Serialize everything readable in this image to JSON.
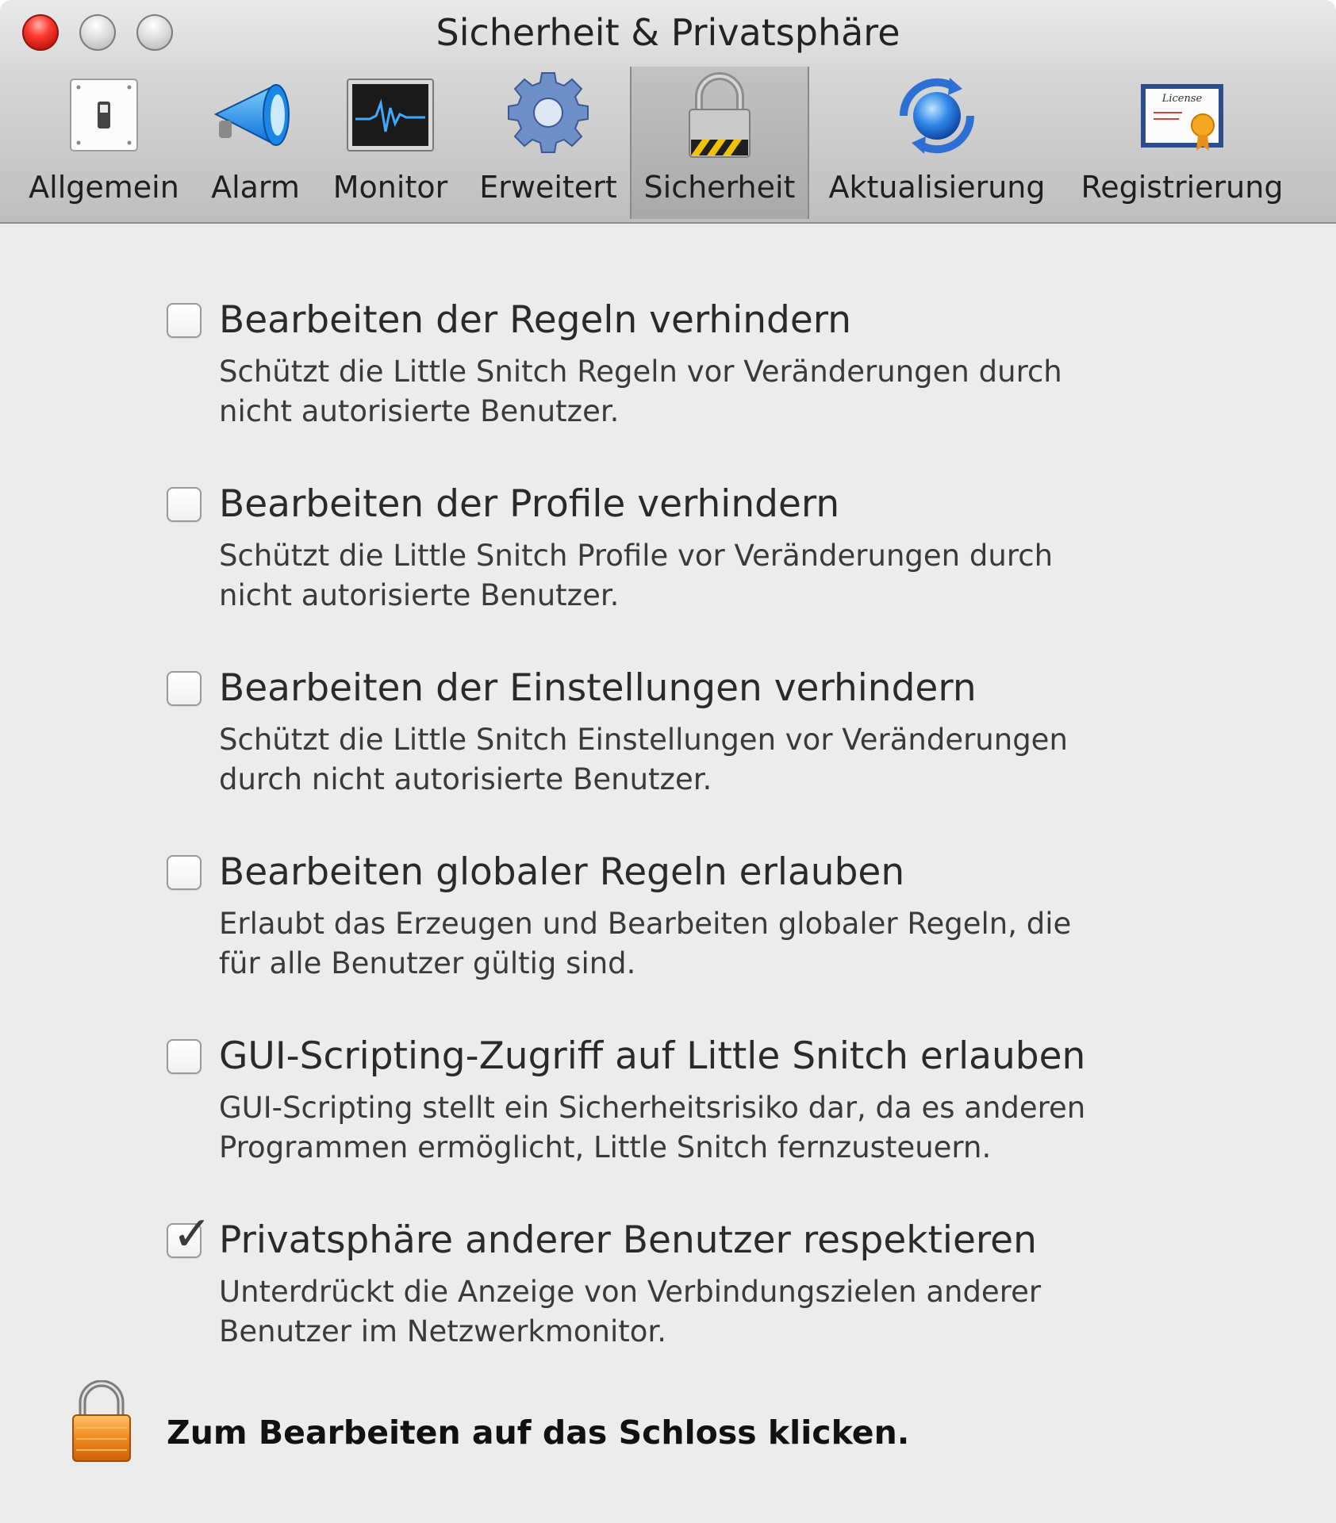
{
  "window": {
    "title": "Sicherheit & Privatsphäre"
  },
  "toolbar": {
    "tabs": [
      {
        "label": "Allgemein",
        "icon": "switch-icon"
      },
      {
        "label": "Alarm",
        "icon": "megaphone-icon"
      },
      {
        "label": "Monitor",
        "icon": "monitor-icon"
      },
      {
        "label": "Erweitert",
        "icon": "gear-icon"
      },
      {
        "label": "Sicherheit",
        "icon": "lock-icon",
        "selected": true
      },
      {
        "label": "Aktualisierung",
        "icon": "update-globe-icon"
      },
      {
        "label": "Registrierung",
        "icon": "license-certificate-icon"
      }
    ]
  },
  "options": [
    {
      "title": "Bearbeiten der Regeln verhindern",
      "desc_lines": [
        "Schützt die Little Snitch Regeln vor Veränderungen durch",
        "nicht autorisierte Benutzer."
      ],
      "checked": false
    },
    {
      "title": "Bearbeiten der Profile verhindern",
      "desc_lines": [
        "Schützt die Little Snitch Profile vor Veränderungen durch",
        "nicht autorisierte Benutzer."
      ],
      "checked": false
    },
    {
      "title": "Bearbeiten der Einstellungen verhindern",
      "desc_lines": [
        "Schützt die Little Snitch Einstellungen vor Veränderungen",
        "durch nicht autorisierte Benutzer."
      ],
      "checked": false
    },
    {
      "title": "Bearbeiten globaler Regeln erlauben",
      "desc_lines": [
        "Erlaubt das Erzeugen und Bearbeiten globaler Regeln, die",
        "für alle Benutzer gültig sind."
      ],
      "checked": false
    },
    {
      "title": "GUI-Scripting-Zugriff auf Little Snitch erlauben",
      "desc_lines": [
        "GUI-Scripting stellt ein Sicherheitsrisiko dar, da es anderen",
        "Programmen ermöglicht, Little Snitch fernzusteuern."
      ],
      "checked": false
    },
    {
      "title": "Privatsphäre anderer Benutzer respektieren",
      "desc_lines": [
        "Unterdrückt die Anzeige von Verbindungszielen anderer",
        "Benutzer im Netzwerkmonitor."
      ],
      "checked": true
    }
  ],
  "lock": {
    "text": "Zum Bearbeiten auf das Schloss klicken.",
    "icon": "padlock-icon"
  },
  "colors": {
    "close_button": "#ff3b30",
    "lock_orange": "#f08a1c",
    "text": "#2a2a2a"
  }
}
